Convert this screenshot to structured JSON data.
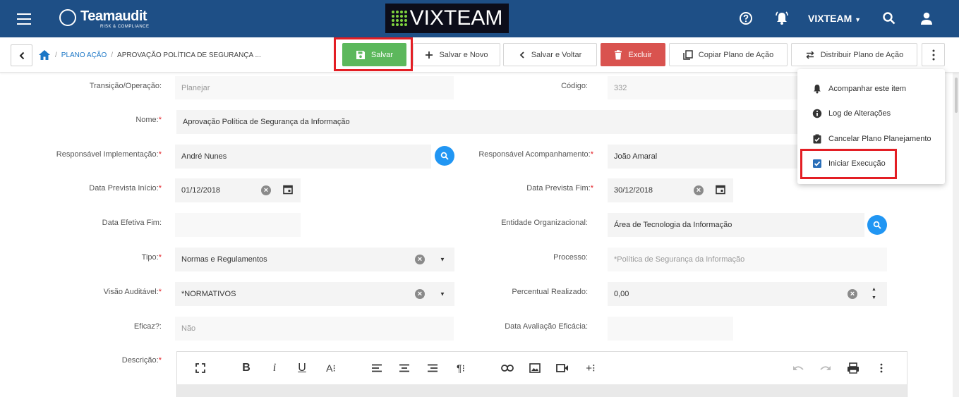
{
  "header": {
    "logo_name": "Teamaudit",
    "logo_sub": "RISK & COMPLIANCE",
    "brand": "VIXTEAM",
    "user": "VIXTEAM",
    "color": "#1e4f86"
  },
  "breadcrumb": {
    "items": [
      "PLANO AÇÃO",
      "APROVAÇÃO POLÍTICA DE SEGURANÇA ..."
    ]
  },
  "toolbar": {
    "save": "Salvar",
    "save_new": "Salvar e Novo",
    "save_back": "Salvar e Voltar",
    "delete": "Excluir",
    "copy": "Copiar Plano de Ação",
    "distribute": "Distribuir Plano de Ação"
  },
  "menu": {
    "follow": "Acompanhar este item",
    "log": "Log de Alterações",
    "cancel": "Cancelar Plano Planejamento",
    "start": "Iniciar Execução"
  },
  "form": {
    "transicao": {
      "label": "Transição/Operação:",
      "value": "Planejar"
    },
    "codigo": {
      "label": "Código:",
      "value": "332"
    },
    "nome": {
      "label": "Nome:",
      "value": "Aprovação Política de Segurança da Informação"
    },
    "resp_impl": {
      "label": "Responsável Implementação:",
      "value": "André Nunes"
    },
    "resp_acomp": {
      "label": "Responsável Acompanhamento:",
      "value": "João Amaral"
    },
    "data_ini": {
      "label": "Data Prevista Início:",
      "value": "01/12/2018"
    },
    "data_fim": {
      "label": "Data Prevista Fim:",
      "value": "30/12/2018"
    },
    "data_efetiva": {
      "label": "Data Efetiva Fim:",
      "value": ""
    },
    "entidade": {
      "label": "Entidade Organizacional:",
      "value": "Área de Tecnologia da Informação"
    },
    "tipo": {
      "label": "Tipo:",
      "value": "Normas e Regulamentos"
    },
    "processo": {
      "label": "Processo:",
      "value": "*Política de Segurança da Informação"
    },
    "visao": {
      "label": "Visão Auditável:",
      "value": "*NORMATIVOS"
    },
    "percentual": {
      "label": "Percentual Realizado:",
      "value": "0,00"
    },
    "eficaz": {
      "label": "Eficaz?:",
      "value": "Não"
    },
    "data_aval": {
      "label": "Data Avaliação Eficácia:",
      "value": ""
    },
    "descricao": {
      "label": "Descrição:"
    },
    "required_mark": "*"
  },
  "editor": {
    "bold": "B",
    "italic": "i",
    "underline": "U",
    "font": "A⁝",
    "paragraph": "¶⁝",
    "insert": "+⁝"
  }
}
